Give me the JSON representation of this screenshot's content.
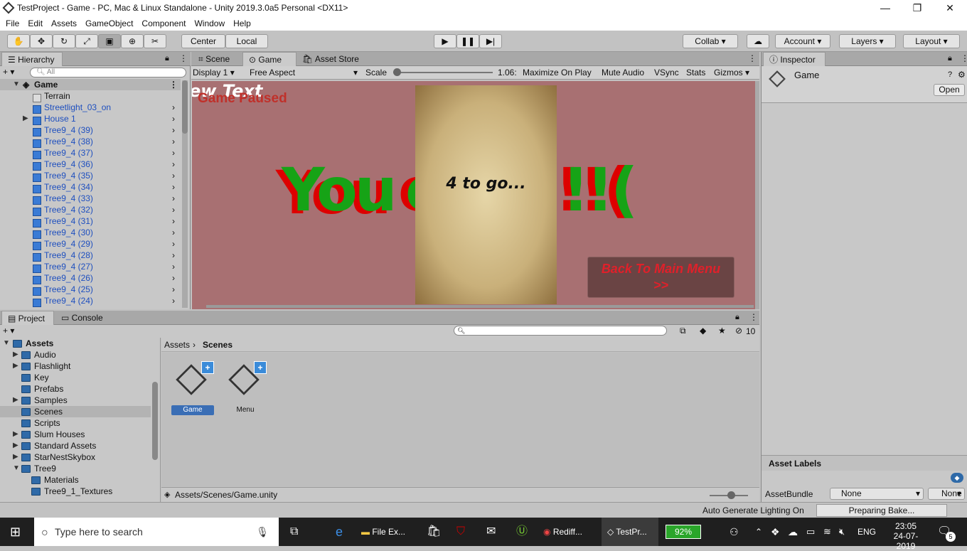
{
  "window": {
    "title": "TestProject - Game - PC, Mac & Linux Standalone - Unity 2019.3.0a5 Personal <DX11>",
    "minimize": "—",
    "maximize": "❐",
    "close": "✕"
  },
  "menu": [
    "File",
    "Edit",
    "Assets",
    "GameObject",
    "Component",
    "Window",
    "Help"
  ],
  "toolbar": {
    "pivot": "Center",
    "space": "Local",
    "collab": "Collab",
    "account": "Account",
    "layers": "Layers",
    "layout": "Layout"
  },
  "hierarchy": {
    "tab": "Hierarchy",
    "search_placeholder": "All",
    "scene": "Game",
    "items": [
      "Terrain",
      "Streetlight_03_on",
      "House 1",
      "Tree9_4 (39)",
      "Tree9_4 (38)",
      "Tree9_4 (37)",
      "Tree9_4 (36)",
      "Tree9_4 (35)",
      "Tree9_4 (34)",
      "Tree9_4 (33)",
      "Tree9_4 (32)",
      "Tree9_4 (31)",
      "Tree9_4 (30)",
      "Tree9_4 (29)",
      "Tree9_4 (28)",
      "Tree9_4 (27)",
      "Tree9_4 (26)",
      "Tree9_4 (25)",
      "Tree9_4 (24)"
    ]
  },
  "view_tabs": {
    "scene": "Scene",
    "game": "Game",
    "store": "Asset Store"
  },
  "game_toolbar": {
    "display": "Display 1",
    "aspect": "Free Aspect",
    "scale_label": "Scale",
    "scale_value": "1.06:",
    "maximize": "Maximize On Play",
    "mute": "Mute Audio",
    "vsync": "VSync",
    "stats": "Stats",
    "gizmos": "Gizmos"
  },
  "game": {
    "new_text": "ew Text",
    "paused": "Game Paused",
    "you": "You",
    "failed_tail": "ed it !!(",
    "to_go": "4 to go...",
    "back_line1": "Back To Main Menu",
    "back_line2": ">>"
  },
  "inspector": {
    "tab": "Inspector",
    "object": "Game",
    "open": "Open",
    "asset_labels": "Asset Labels",
    "assetbundle": "AssetBundle",
    "bundle_value": "None",
    "variant_value": "None"
  },
  "project": {
    "tab": "Project",
    "console_tab": "Console",
    "count": "10",
    "root": "Assets",
    "folders": [
      "Audio",
      "Flashlight",
      "Key",
      "Prefabs",
      "Samples",
      "Scenes",
      "Scripts",
      "Slum Houses",
      "Standard Assets",
      "StarNestSkybox",
      "Tree9",
      "Materials",
      "Tree9_1_Textures"
    ],
    "breadcrumb_root": "Assets",
    "breadcrumb_current": "Scenes",
    "assets": [
      "Game",
      "Menu"
    ],
    "path": "Assets/Scenes/Game.unity"
  },
  "status": {
    "lighting": "Auto Generate Lighting On",
    "bake": "Preparing Bake..."
  },
  "taskbar": {
    "search": "Type here to search",
    "file_explorer": "File Ex...",
    "rediff": "Rediff...",
    "unity": "TestPr...",
    "battery": "92%",
    "lang": "ENG",
    "time": "23:05",
    "date": "24-07-2019",
    "notif": "5"
  }
}
